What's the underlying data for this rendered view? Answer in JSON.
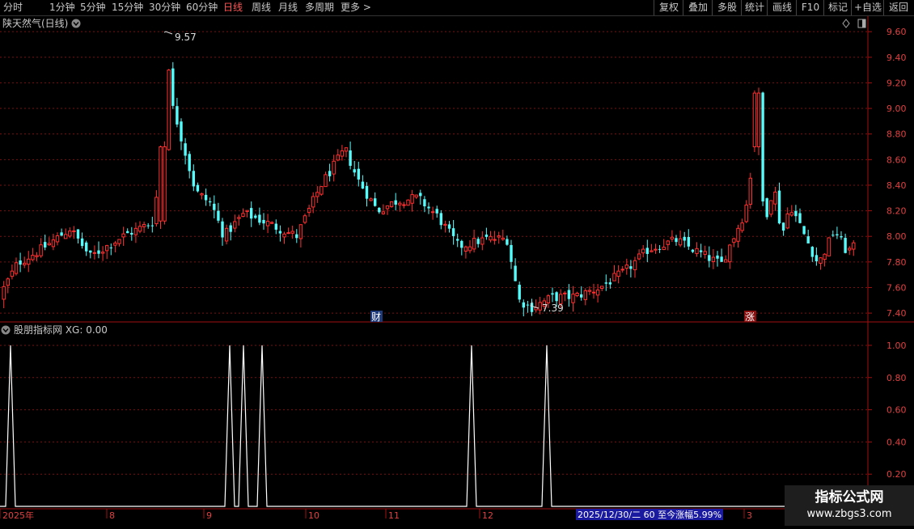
{
  "toolbar": {
    "periods": [
      "分时",
      "1分钟",
      "5分钟",
      "15分钟",
      "30分钟",
      "60分钟",
      "日线",
      "周线",
      "月线",
      "多周期",
      "更多 >"
    ],
    "active_period": "日线",
    "right_buttons": [
      "复权",
      "叠加",
      "多股",
      "统计",
      "画线",
      "F10",
      "标记",
      "+自选",
      "返回"
    ]
  },
  "main_panel": {
    "title": "陕天然气(日线)",
    "y_ticks": [
      "9.60",
      "9.40",
      "9.20",
      "9.00",
      "8.80",
      "8.60",
      "8.40",
      "8.20",
      "8.00",
      "7.80",
      "7.60",
      "7.40"
    ],
    "high_label": "9.57",
    "low_label": "7.39",
    "marker_cai": "财",
    "marker_zhang": "涨"
  },
  "indicator_panel": {
    "title": "股朋指标网 XG: 0.00",
    "y_ticks": [
      "1.00",
      "0.80",
      "0.60",
      "0.40",
      "0.20"
    ]
  },
  "date_axis": {
    "labels": [
      "2025年",
      "8",
      "9",
      "10",
      "11",
      "12",
      "3"
    ],
    "status_text": "2025/12/30/二 60 至今涨幅5.99%"
  },
  "watermark": {
    "title": "指标公式网",
    "url": "www.zbgs3.com"
  },
  "colors": {
    "up": "#ff3030",
    "down": "#54fcfc",
    "grid": "#7a1010",
    "axis": "#a01010",
    "active": "#ff5555",
    "status_bg": "#1a1aa0"
  },
  "chart_data": {
    "type": "candlestick",
    "series": [
      {
        "name": "XG",
        "peak_values": [
          1,
          1,
          1,
          1,
          1,
          1
        ],
        "base_value": 0
      }
    ],
    "price_range": [
      7.35,
      9.62
    ],
    "indicator_range": [
      0,
      1.05
    ],
    "grid": true
  }
}
